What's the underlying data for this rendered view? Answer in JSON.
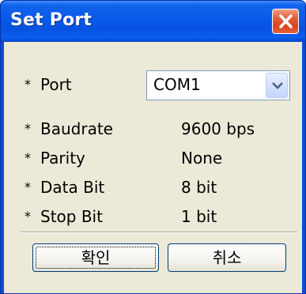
{
  "window": {
    "title": "Set Port",
    "close_icon": "close-icon"
  },
  "fields": [
    {
      "bullet": "*",
      "label": "Port"
    },
    {
      "bullet": "*",
      "label": "Baudrate",
      "value": "9600 bps"
    },
    {
      "bullet": "*",
      "label": "Parity",
      "value": "None"
    },
    {
      "bullet": "*",
      "label": "Data Bit",
      "value": "8 bit"
    },
    {
      "bullet": "*",
      "label": "Stop Bit",
      "value": "1 bit"
    }
  ],
  "port_select": {
    "selected": "COM1",
    "icon": "chevron-down-icon"
  },
  "buttons": {
    "ok_label": "확인",
    "cancel_label": "취소"
  },
  "colors": {
    "title_bar": "#0a58e8",
    "client_bg": "#ece9d8",
    "close_button": "#d9431f"
  }
}
